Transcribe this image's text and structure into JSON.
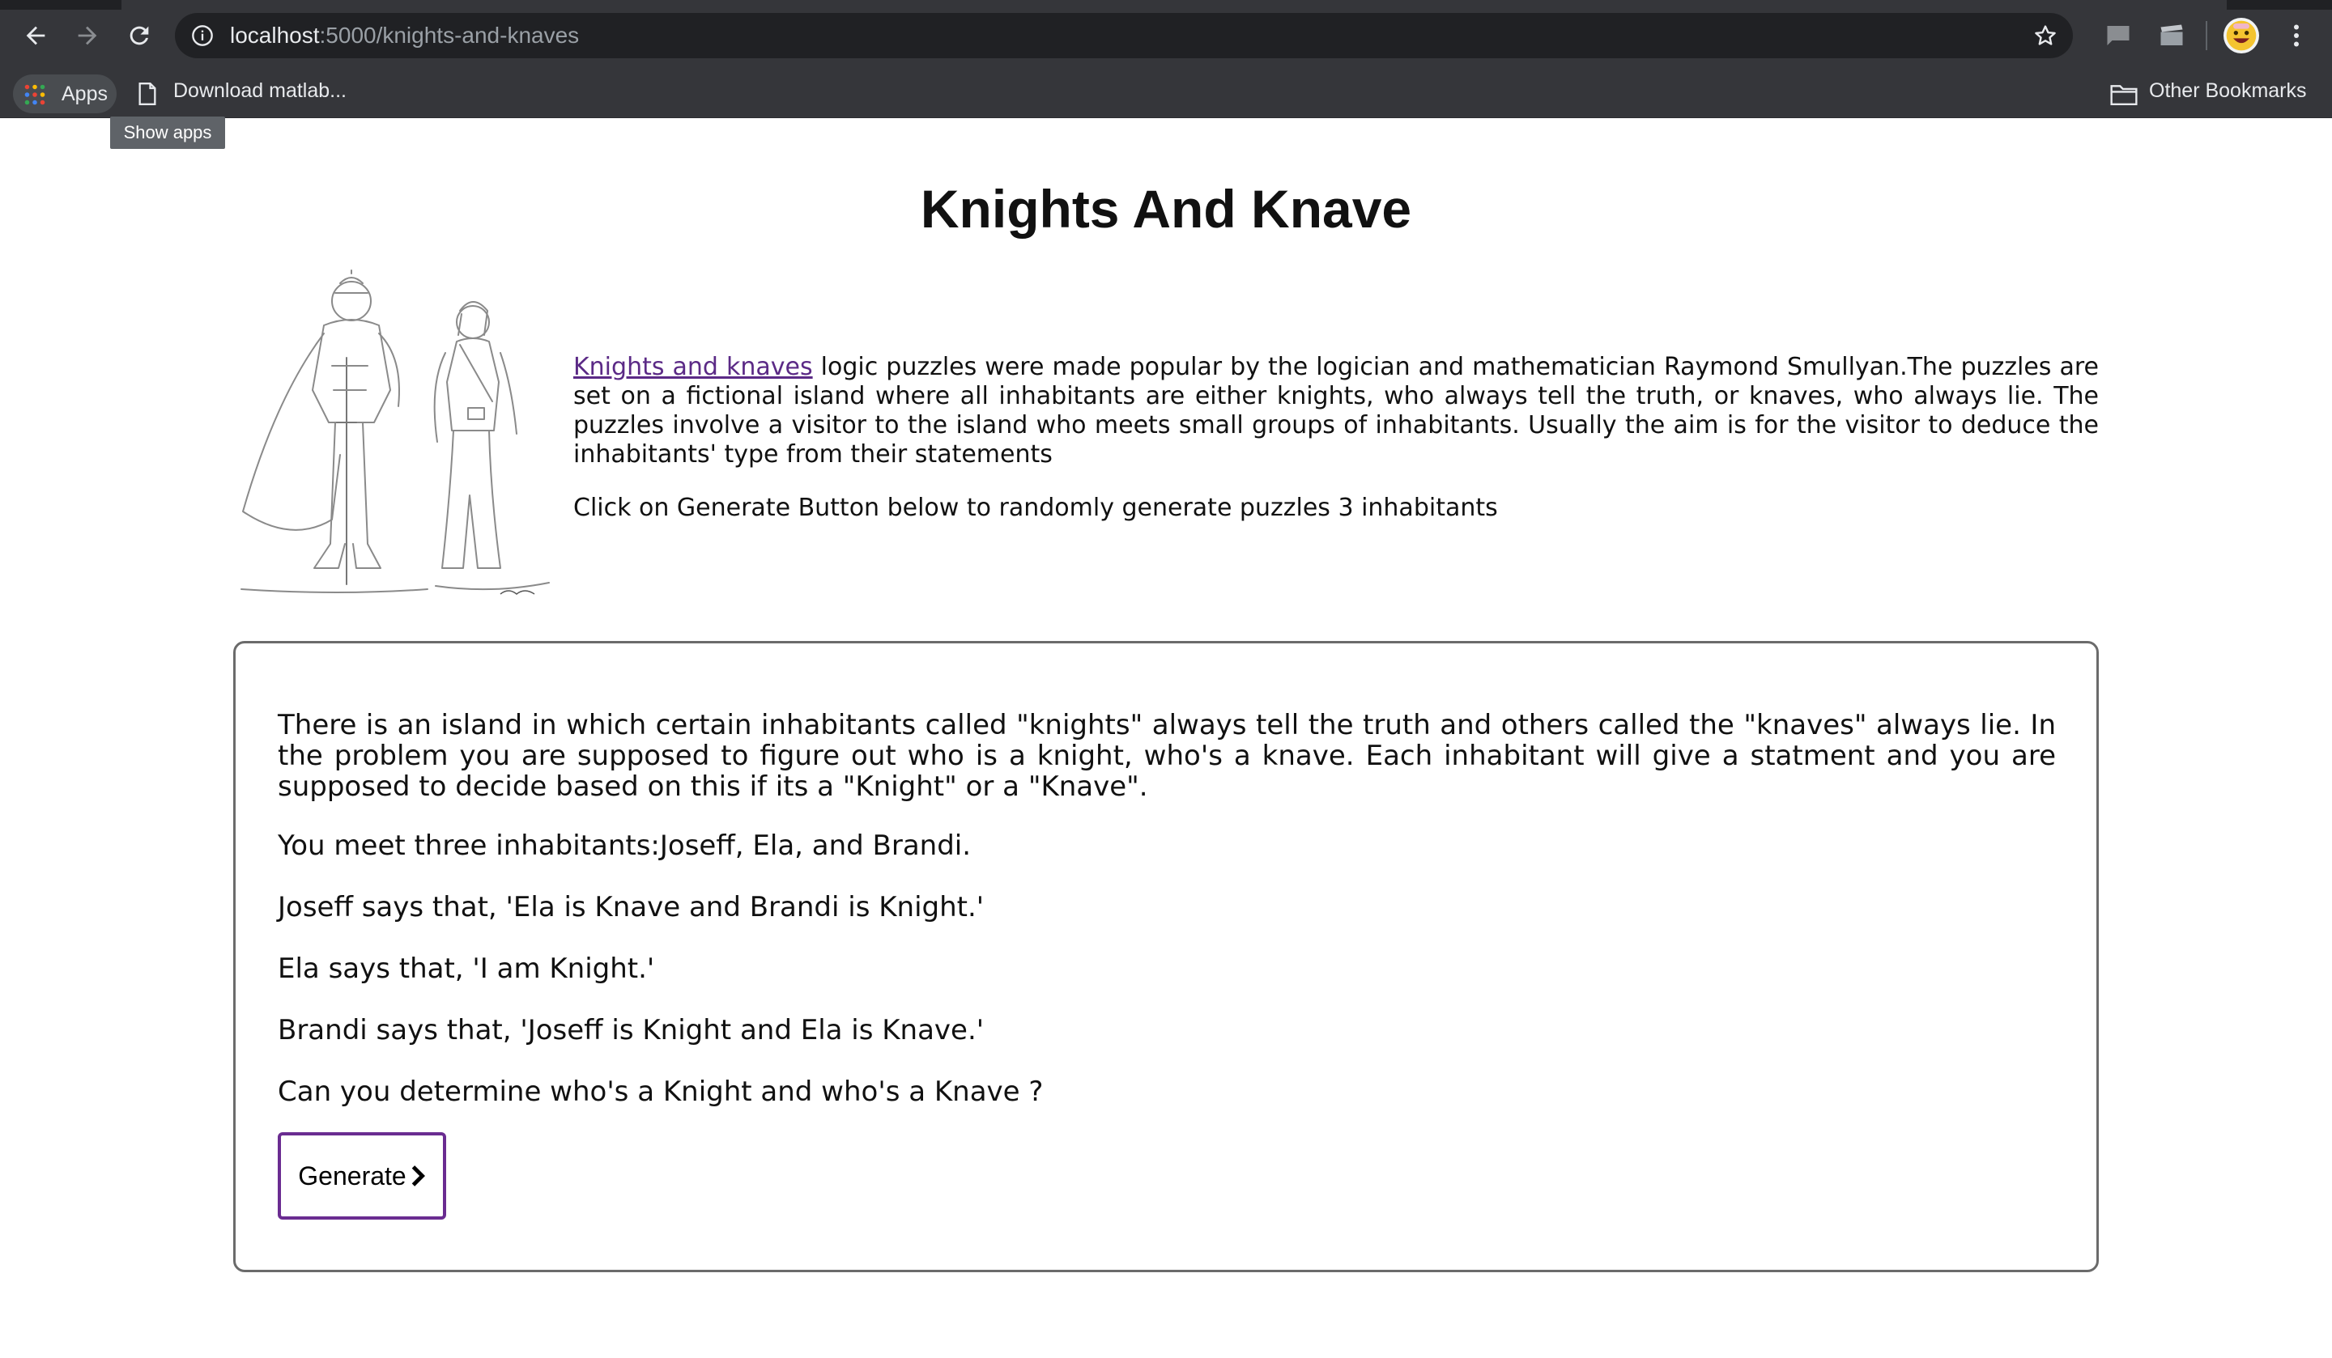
{
  "browser": {
    "url_host": "localhost",
    "url_path": ":5000/knights-and-knaves",
    "bookmarks": {
      "apps_label": "Apps",
      "item_1": "Download matlab...",
      "other": "Other Bookmarks"
    },
    "tooltip": "Show apps"
  },
  "page": {
    "title": "Knights And Knave",
    "intro": {
      "link_text": "Knights and knaves",
      "body": " logic puzzles were made popular by the logician and mathematician Raymond Smullyan.The puzzles are set on a fictional island where all inhabitants are either knights, who always tell the truth, or knaves, who always lie. The puzzles involve a visitor to the island who meets small groups of inhabitants. Usually the aim is for the visitor to deduce the inhabitants' type from their statements",
      "cta": "Click on Generate Button below to randomly generate puzzles 3 inhabitants"
    },
    "puzzle": {
      "description": "There is an island in which certain inhabitants called \"knights\" always tell the truth and others called the \"knaves\" always lie. In the problem you are supposed to figure out who is a knight, who's a knave. Each inhabitant will give a statment and you are supposed to decide based on this if its a \"Knight\" or a \"Knave\".",
      "meet": "You meet three inhabitants:Joseff, Ela, and Brandi.",
      "statements": [
        "Joseff says that, 'Ela is Knave and Brandi is Knight.'",
        "Ela says that, 'I am Knight.'",
        "Brandi says that, 'Joseff is Knight and Ela is Knave.'"
      ],
      "question": "Can you determine who's a Knight and who's a Knave ?",
      "button_label": "Generate"
    }
  },
  "colors": {
    "chrome": "#35363a",
    "omnibox": "#202124",
    "link": "#5b2a86",
    "button_border": "#6a2c91"
  }
}
